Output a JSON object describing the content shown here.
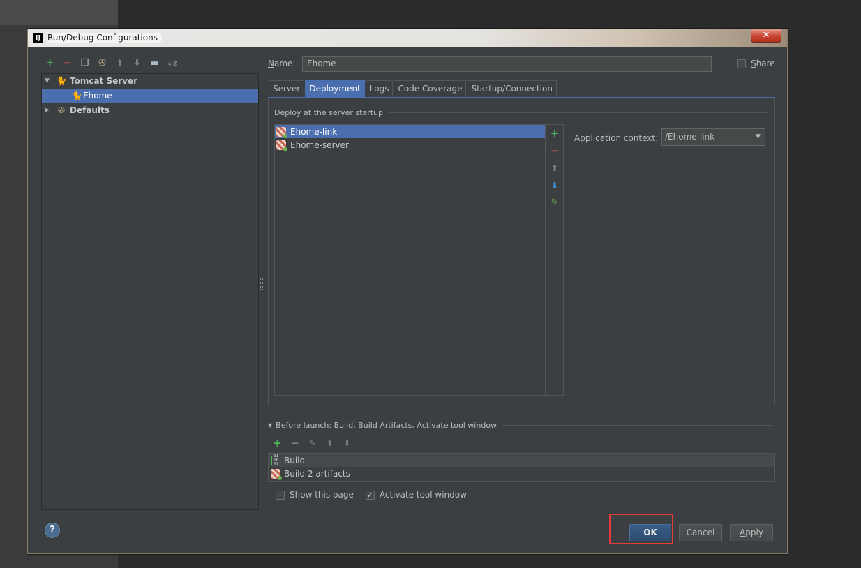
{
  "window": {
    "title": "Run/Debug Configurations",
    "logo": "IJ",
    "close_glyph": "✕"
  },
  "left_toolbar": {
    "icons": [
      "add-icon",
      "remove-icon",
      "copy-icon",
      "edit-defaults-icon",
      "move-up-icon",
      "move-down-icon",
      "folder-icon",
      "sort-icon"
    ]
  },
  "tree": {
    "items": [
      {
        "label": "Tomcat Server",
        "expanded": true
      },
      {
        "label": "Ehome",
        "selected": true
      },
      {
        "label": "Defaults",
        "expanded": false
      }
    ]
  },
  "name_row": {
    "label_prefix": "N",
    "label_rest": "ame:",
    "value": "Ehome",
    "share_label_u": "S",
    "share_label_rest": "hare",
    "share_checked": false
  },
  "tabs": [
    {
      "label": "Server",
      "active": false
    },
    {
      "label": "Deployment",
      "active": true
    },
    {
      "label": "Logs",
      "active": false
    },
    {
      "label": "Code Coverage",
      "active": false
    },
    {
      "label": "Startup/Connection",
      "active": false
    }
  ],
  "deployment": {
    "section_title": "Deploy at the server startup",
    "artifacts": [
      {
        "label": "Ehome-link",
        "selected": true
      },
      {
        "label": "Ehome-server",
        "selected": false
      }
    ],
    "side_buttons": {
      "add": "+",
      "remove": "−",
      "up": "⬆",
      "down": "⬇",
      "edit": "✎"
    },
    "app_context_label": "Application context:",
    "app_context_value": "/Ehome-link",
    "dropdown_glyph": "▼"
  },
  "before_launch": {
    "title": "Before launch: Build, Build Artifacts, Activate tool window",
    "tasks": [
      {
        "label": "Build"
      },
      {
        "label": "Build 2 artifacts"
      }
    ]
  },
  "options": {
    "show_page_label": "Show this page",
    "show_page_checked": false,
    "activate_label": "Activate tool window",
    "activate_checked": true
  },
  "buttons": {
    "help": "?",
    "ok": "OK",
    "cancel": "Cancel",
    "apply_u": "A",
    "apply_rest": "pply"
  },
  "colors": {
    "selection": "#4b6eaf",
    "highlight_box": "#e23b3b",
    "add_green": "#4bb85a",
    "remove_red": "#d8514b"
  }
}
